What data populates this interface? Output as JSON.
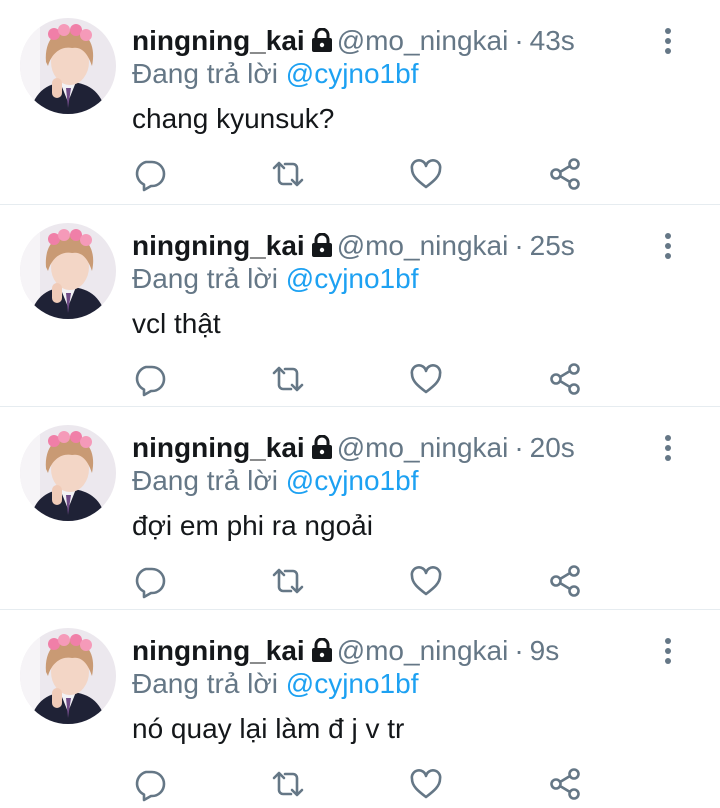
{
  "colors": {
    "name": "#14171a",
    "secondary": "#657786",
    "mention": "#1da1f2",
    "divider": "#e6ecf0"
  },
  "icons": [
    "lock-icon",
    "more-icon",
    "reply-icon",
    "retweet-icon",
    "like-icon",
    "share-icon"
  ],
  "tweets": [
    {
      "name": "ningning_kai",
      "handle": "@mo_ningkai",
      "dot": "·",
      "time": "43s",
      "reply_prefix": "Đang trả lời",
      "reply_to": "@cyjno1bf",
      "text": "chang kyunsuk?"
    },
    {
      "name": "ningning_kai",
      "handle": "@mo_ningkai",
      "dot": "·",
      "time": "25s",
      "reply_prefix": "Đang trả lời",
      "reply_to": "@cyjno1bf",
      "text": "vcl thật"
    },
    {
      "name": "ningning_kai",
      "handle": "@mo_ningkai",
      "dot": "·",
      "time": "20s",
      "reply_prefix": "Đang trả lời",
      "reply_to": "@cyjno1bf",
      "text": "đợi em phi ra ngoải"
    },
    {
      "name": "ningning_kai",
      "handle": "@mo_ningkai",
      "dot": "·",
      "time": "9s",
      "reply_prefix": "Đang trả lời",
      "reply_to": "@cyjno1bf",
      "text": "nó quay lại làm đ j v tr"
    }
  ]
}
